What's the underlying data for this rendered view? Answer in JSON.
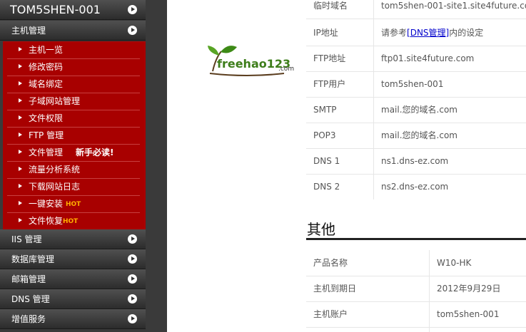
{
  "sidebar": {
    "site_name": "TOM5SHEN-001",
    "host_mgmt": "主机管理",
    "items": [
      {
        "label": "主机一览"
      },
      {
        "label": "修改密码"
      },
      {
        "label": "域名绑定"
      },
      {
        "label": "子域网站管理"
      },
      {
        "label": "文件权限"
      },
      {
        "label": "FTP 管理"
      },
      {
        "label": "文件管理",
        "note": "新手必读!"
      },
      {
        "label": "流量分析系统"
      },
      {
        "label": "下载网站日志"
      },
      {
        "label": "一键安装",
        "badge": "HOT"
      },
      {
        "label": "文件恢复",
        "badge": "HOT"
      }
    ],
    "sections": [
      {
        "label": "IIS 管理"
      },
      {
        "label": "数据库管理"
      },
      {
        "label": "邮箱管理"
      },
      {
        "label": "DNS 管理"
      },
      {
        "label": "增值服务"
      }
    ]
  },
  "logo": {
    "word": "freehao123",
    "suffix": ".com"
  },
  "info": {
    "rows": [
      {
        "key": "临时域名",
        "value": "tom5shen-001-site1.site4future.com"
      },
      {
        "key": "IP地址",
        "value_pre": "请参考",
        "value_link": "[DNS管理]",
        "value_post": "内的设定"
      },
      {
        "key": "FTP地址",
        "value": "ftp01.site4future.com"
      },
      {
        "key": "FTP用户",
        "value": "tom5shen-001"
      },
      {
        "key": "SMTP",
        "value": "mail.您的域名.com"
      },
      {
        "key": "POP3",
        "value": "mail.您的域名.com"
      },
      {
        "key": "DNS 1",
        "value": "ns1.dns-ez.com"
      },
      {
        "key": "DNS 2",
        "value": "ns2.dns-ez.com"
      }
    ]
  },
  "other": {
    "title": "其他",
    "rows": [
      {
        "key": "产品名称",
        "value": "W10-HK"
      },
      {
        "key": "主机到期日",
        "value": "2012年9月29日"
      },
      {
        "key": "主机账户",
        "value": "tom5shen-001"
      }
    ]
  }
}
